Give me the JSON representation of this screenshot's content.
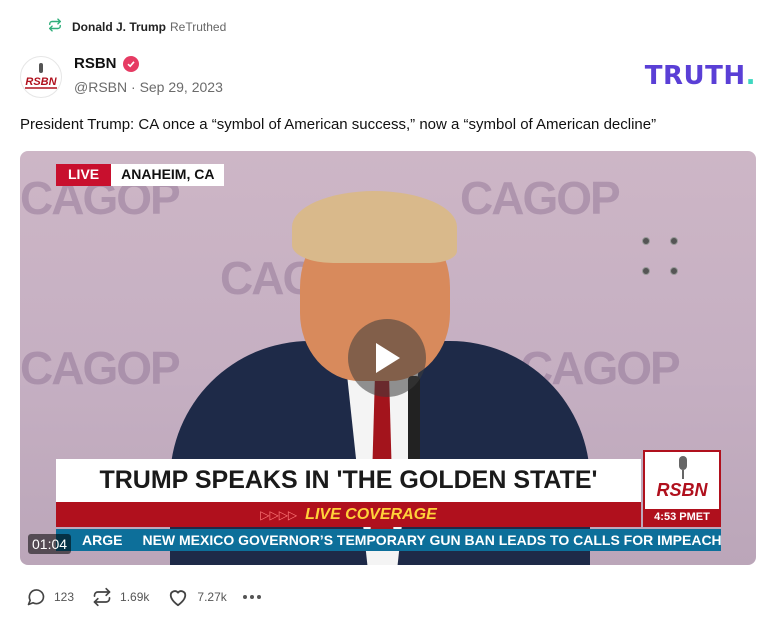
{
  "retruth": {
    "user": "Donald J. Trump",
    "verb": "ReTruthed",
    "icon": "retruth-icon"
  },
  "author": {
    "display_name": "RSBN",
    "verified_icon": "verified-badge-icon",
    "handle": "@RSBN",
    "date": "Sep 29, 2023",
    "meta_sep": " · "
  },
  "brand": {
    "logo_text": "TRUTH",
    "logo_dot": ".",
    "accent": "#5a3fd6",
    "dot_color": "#3ed7c0"
  },
  "post": {
    "text": "President Trump: CA once a “symbol of American success,” now a “symbol of American decline”"
  },
  "video": {
    "duration": "01:04",
    "live_label": "LIVE",
    "location": "ANAHEIM, CA",
    "backdrop_text": "CAGOP",
    "headline": "TRUMP SPEAKS IN 'THE GOLDEN STATE'",
    "coverage_arrows": "▷▷▷▷",
    "coverage": "LIVE COVERAGE",
    "network": "RSBN",
    "time": "4:53 PMET",
    "ticker_lead": "ARGE",
    "ticker": "NEW MEXICO GOVERNOR’S TEMPORARY GUN BAN LEADS TO CALLS FOR IMPEACHMENT",
    "play_icon": "play-icon"
  },
  "actions": {
    "replies": "123",
    "retruths": "1.69k",
    "likes": "7.27k",
    "reply_icon": "reply-icon",
    "retruth_icon": "retruth-icon",
    "like_icon": "heart-icon",
    "more_icon": "more-icon"
  }
}
